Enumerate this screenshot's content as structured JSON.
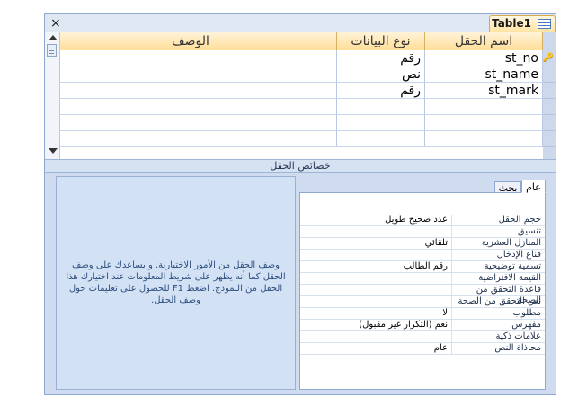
{
  "window": {
    "close_label": "×",
    "tab_title": "Table1"
  },
  "grid": {
    "headers": {
      "field_name": "اسم الحقل",
      "data_type": "نوع البيانات",
      "description": "الوصف"
    },
    "rows": [
      {
        "field_name": "st_no",
        "data_type": "رقم",
        "description": "",
        "primary_key": true
      },
      {
        "field_name": "st_name",
        "data_type": "نص",
        "description": ""
      },
      {
        "field_name": "st_mark",
        "data_type": "رقم",
        "description": ""
      },
      {
        "field_name": "",
        "data_type": "",
        "description": ""
      },
      {
        "field_name": "",
        "data_type": "",
        "description": ""
      },
      {
        "field_name": "",
        "data_type": "",
        "description": ""
      }
    ]
  },
  "properties": {
    "section_title": "خصائص الحقل",
    "tabs": [
      {
        "label": "عام",
        "selected": true
      },
      {
        "label": "بحث",
        "selected": false
      }
    ],
    "rows": [
      {
        "label": "حجم الحقل",
        "value": "عدد صحيح طويل"
      },
      {
        "label": "تنسيق",
        "value": ""
      },
      {
        "label": "المنازل العشرية",
        "value": "تلقائي"
      },
      {
        "label": "قناع الإدخال",
        "value": ""
      },
      {
        "label": "تسمية توضيحية",
        "value": "رقم الطالب"
      },
      {
        "label": "القيمة الافتراضية",
        "value": ""
      },
      {
        "label": "قاعدة التحقق من الصحة",
        "value": ""
      },
      {
        "label": "نص التحقق من الصحة",
        "value": ""
      },
      {
        "label": "مطلوب",
        "value": "لا"
      },
      {
        "label": "مفهرس",
        "value": "نعم (التكرار غير مقبول)"
      },
      {
        "label": "علامات ذكية",
        "value": ""
      },
      {
        "label": "محاذاة النص",
        "value": "عام"
      }
    ],
    "help_text": "وصف الحقل من الأمور الاختيارية. و يساعدك على وصف الحقل كما أنه يظهر على شريط المعلومات عند اختيارك هذا الحقل من النموذج. اضغط F1 للحصول على تعليمات حول وصف الحقل."
  },
  "icons": {
    "key": "key-icon",
    "table": "table-icon"
  }
}
